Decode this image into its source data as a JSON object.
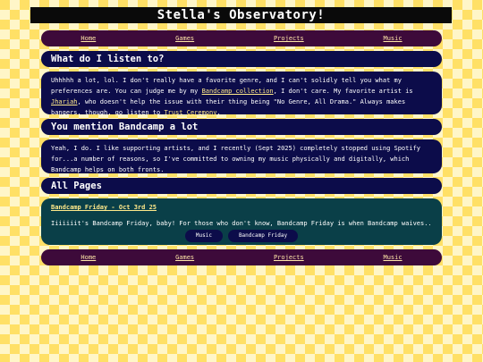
{
  "site_title": "Stella's Observatory!",
  "nav": {
    "home": "Home",
    "games": "Games",
    "projects": "Projects",
    "music": "Music"
  },
  "section1": {
    "heading": "What do I listen to?",
    "text_a": "Uhhhhh a lot, lol. I don't really have a favorite genre, and I can't solidly tell you what my preferences are. You can judge me by my ",
    "link_bandcamp": "Bandcamp collection",
    "text_b": ", I don't care. My favorite artist is ",
    "link_artist": "Jhariah",
    "text_c": ", who doesn't help the issue with their thing being \"No Genre, All Drama.\" Always makes bangers, though, go listen to ",
    "link_album": "Trust Ceremony",
    "text_d": "."
  },
  "section2": {
    "heading": "You mention Bandcamp a lot",
    "text": "Yeah, I do. I like supporting artists, and I recently (Sept 2025) completely stopped using Spotify for...a number of reasons, so I've committed to owning my music physically and digitally, which Bandcamp helps on both fronts."
  },
  "section3": {
    "heading": "All Pages",
    "card_title": "Bandcamp Friday - Oct 3rd 25",
    "card_text": "Iiiiiiit's Bandcamp Friday, baby! For those who don't know, Bandcamp Friday is when Bandcamp waives...",
    "tags": [
      "Music",
      "Bandcamp Friday"
    ]
  }
}
